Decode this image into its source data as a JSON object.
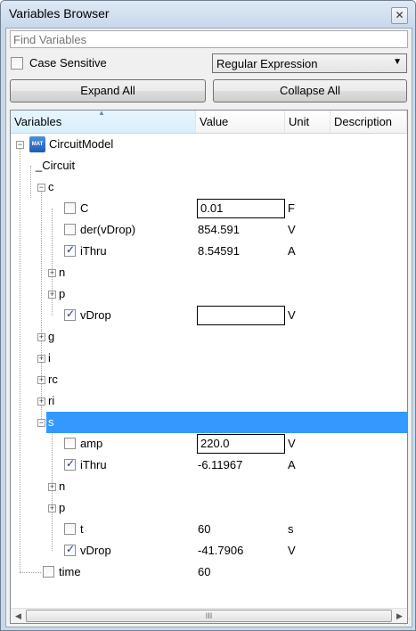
{
  "window": {
    "title": "Variables Browser",
    "close_glyph": "✕"
  },
  "search": {
    "placeholder": "Find Variables"
  },
  "case_sensitive": {
    "label": "Case Sensitive",
    "checked": false
  },
  "filter_mode": {
    "selected": "Regular Expression"
  },
  "buttons": {
    "expand_all": "Expand All",
    "collapse_all": "Collapse All"
  },
  "columns": {
    "variables": "Variables",
    "value": "Value",
    "unit": "Unit",
    "description": "Description"
  },
  "tree": {
    "root": "CircuitModel",
    "circuit": "_Circuit",
    "c": {
      "label": "c",
      "C": {
        "name": "C",
        "value": "0.01",
        "unit": "F",
        "checked": false
      },
      "der": {
        "name": "der(vDrop)",
        "value": "854.591",
        "unit": "V",
        "checked": false
      },
      "iThru": {
        "name": "iThru",
        "value": "8.54591",
        "unit": "A",
        "checked": true
      },
      "n": "n",
      "p": "p",
      "vDrop": {
        "name": "vDrop",
        "value": "",
        "unit": "V",
        "checked": true
      }
    },
    "g": "g",
    "i": "i",
    "rc": "rc",
    "ri": "ri",
    "s": {
      "label": "s",
      "amp": {
        "name": "amp",
        "value": "220.0",
        "unit": "V",
        "checked": false
      },
      "iThru": {
        "name": "iThru",
        "value": "-6.11967",
        "unit": "A",
        "checked": true
      },
      "n": "n",
      "p": "p",
      "t": {
        "name": "t",
        "value": "60",
        "unit": "s",
        "checked": false
      },
      "vDrop": {
        "name": "vDrop",
        "value": "-41.7906",
        "unit": "V",
        "checked": true
      }
    },
    "time": {
      "name": "time",
      "value": "60",
      "unit": "",
      "checked": false
    }
  },
  "mat_icon_text": "MAT",
  "scroll_grip": "III"
}
